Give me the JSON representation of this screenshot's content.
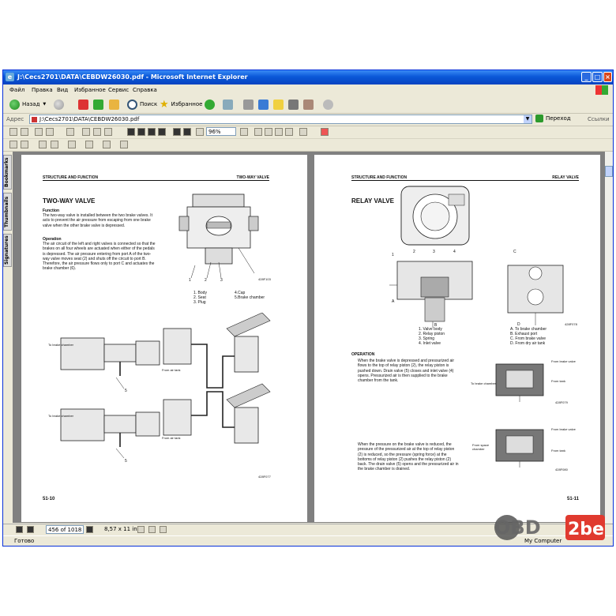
{
  "window": {
    "title": "J:\\Cecs2701\\DATA\\CEBDW26030.pdf - Microsoft Internet Explorer",
    "controls": {
      "minimize": "_",
      "maximize": "□",
      "close": "×"
    }
  },
  "menu": [
    "Файл",
    "Правка",
    "Вид",
    "Избранное",
    "Сервис",
    "Справка"
  ],
  "toolbar": {
    "back": "Назад",
    "search": "Поиск",
    "favorites": "Избранное"
  },
  "address": {
    "label": "Адрес",
    "value": "J:\\Cecs2701\\DATA\\CEBDW26030.pdf",
    "go": "Переход",
    "links": "Ссылки"
  },
  "acrobat": {
    "zoom": "96%"
  },
  "sidetabs": [
    "Bookmarks",
    "Thumbnails",
    "Signatures"
  ],
  "pagebar": {
    "page": "456 of 1018",
    "size": "8,57 x 11 in"
  },
  "status": {
    "text": "Готово",
    "zone": "My Computer"
  },
  "watermark": {
    "text": "OBD2be"
  },
  "page1": {
    "header_left": "STRUCTURE AND FUNCTION",
    "header_right": "TWO-WAY VALVE",
    "title": "TWO-WAY VALVE",
    "function_head": "Function",
    "function_text": "The two-way valve is installed between the two brake valves. It acts to prevent the air pressure from escaping from one brake valve when the other brake valve is depressed.",
    "operation_head": "Operation",
    "operation_text": "The air circuit of the left and right valves is connected so that the brakes on all four wheels are actuated when either of the pedals is depressed. The air pressure entering from port A of the two-way valve moves seat (2) and shuts off the circuit to port B. Therefore, the air pressure flows only to port C and actuates the brake chamber (6).",
    "legend": [
      "1.  Body",
      "2.  Seat",
      "3.  Plug",
      "4.Cap",
      "5.Brake chamber"
    ],
    "fig_code1": "428F103",
    "label_to_brake_1": "To brake chamber",
    "label_from_tank_1": "From air tank",
    "label_to_brake_2": "To brake chamber",
    "label_from_tank_2": "From air tank",
    "fig_code2": "428F077",
    "page_num": "51-10",
    "callouts": [
      "1",
      "2",
      "3",
      "5",
      "5"
    ]
  },
  "page2": {
    "header_left": "STRUCTURE AND FUNCTION",
    "header_right": "RELAY VALVE",
    "title": "RELAY VALVE",
    "legend_left": [
      "1.  Valve body",
      "2.  Relay piston",
      "3.  Spring",
      "4.  Inlet valve"
    ],
    "legend_right": [
      "A.  To brake chamber",
      "B.  Exhaust port",
      "C.  From brake valve",
      "D.  From dry air tank"
    ],
    "fig_code1": "428F078",
    "operation_head": "OPERATION",
    "op_text1": "When the brake valve is depressed and pressurized air flows to the top of relay piston (2), the relay piston is pushed down. Drain valve (5) closes and inlet valve (4) opens. Pressurized air is then supplied to the brake chamber from the tank.",
    "op_text2": "When the pressure on the brake valve is reduced, the pressure of the pressurized air at the top of relay piston (2) is reduced, so the pressure (spring force) at the bottoms of relay piston (2) pushes the relay piston (2) back. The drain valve (5) opens and the pressurized air in the brake chamber is drained.",
    "label_from_brake": "From brake valve",
    "label_from_tank": "From tank",
    "label_to_brake": "To brake chamber",
    "label_from_brake2": "From brake valve",
    "label_from_tank2": "From tank",
    "label_from_space": "From space chamber",
    "fig_code2": "428F079",
    "fig_code3": "428F080",
    "page_num": "51-11",
    "callouts_top": [
      "1",
      "2",
      "3",
      "4"
    ],
    "callouts_side": [
      "A",
      "B",
      "C",
      "D"
    ]
  }
}
